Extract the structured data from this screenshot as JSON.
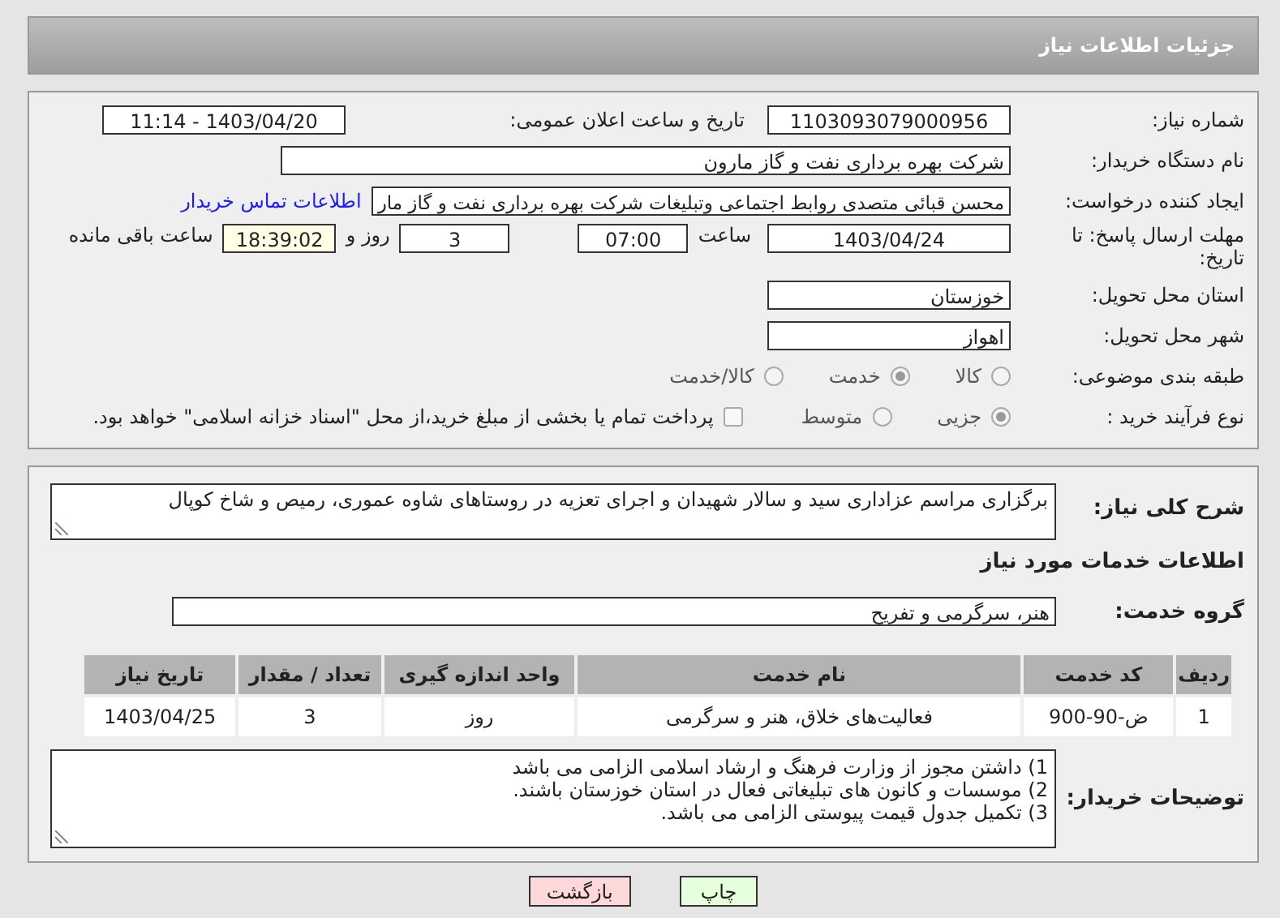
{
  "header": {
    "title": "جزئیات اطلاعات نیاز"
  },
  "need_number": {
    "label": "شماره نیاز:",
    "value": "1103093079000956"
  },
  "announce": {
    "label": "تاریخ و ساعت اعلان عمومی:",
    "value": "1403/04/20 - 11:14"
  },
  "buyer_org": {
    "label": "نام دستگاه خریدار:",
    "value": "شرکت بهره برداری نفت و گاز مارون"
  },
  "creator": {
    "label": "ایجاد کننده درخواست:",
    "value": "محسن قبائی متصدی روابط اجتماعی وتبلیغات شرکت بهره برداری نفت و گاز مار",
    "link": "اطلاعات تماس خریدار"
  },
  "deadline": {
    "label": "مهلت ارسال پاسخ: تا تاریخ:",
    "date": "1403/04/24",
    "time_label": "ساعت",
    "time": "07:00",
    "days": "3",
    "days_label": "روز و",
    "remaining": "18:39:02",
    "remaining_label": "ساعت باقی مانده"
  },
  "province": {
    "label": "استان محل تحویل:",
    "value": "خوزستان"
  },
  "city": {
    "label": "شهر محل تحویل:",
    "value": "اهواز"
  },
  "category": {
    "label": "طبقه بندی موضوعی:",
    "options": [
      {
        "label": "کالا",
        "selected": false
      },
      {
        "label": "خدمت",
        "selected": true
      },
      {
        "label": "کالا/خدمت",
        "selected": false
      }
    ]
  },
  "process": {
    "label": "نوع فرآیند خرید :",
    "options": [
      {
        "label": "جزیی",
        "selected": true
      },
      {
        "label": "متوسط",
        "selected": false
      }
    ],
    "payment": {
      "label": "پرداخت تمام یا بخشی از مبلغ خرید،از محل \"اسناد خزانه اسلامی\" خواهد بود.",
      "checked": false
    }
  },
  "description": {
    "label": "شرح کلی نیاز:",
    "value": "برگزاری مراسم  عزاداری سید و سالار شهیدان و اجرای تعزیه در روستاهای شاوه عموری، رمیص و شاخ کوپال"
  },
  "services_title": "اطلاعات خدمات مورد نیاز",
  "service_group": {
    "label": "گروه خدمت:",
    "value": "هنر، سرگرمی و تفریح"
  },
  "table": {
    "columns": [
      "ردیف",
      "کد خدمت",
      "نام خدمت",
      "واحد اندازه گیری",
      "تعداد / مقدار",
      "تاریخ نیاز"
    ],
    "rows": [
      [
        "1",
        "ض-90-900",
        "فعالیت‌های خلاق، هنر و سرگرمی",
        "روز",
        "3",
        "1403/04/25"
      ]
    ]
  },
  "buyer_notes": {
    "label": "توضیحات خریدار:",
    "lines": [
      "1) داشتن مجوز از وزارت فرهنگ و ارشاد اسلامی الزامی می باشد",
      "2) موسسات و کانون های تبلیغاتی فعال در استان خوزستان باشند.",
      "3) تکمیل جدول قیمت پیوستی الزامی می باشد."
    ]
  },
  "buttons": [
    {
      "label": "چاپ",
      "kind": "print"
    },
    {
      "label": "بازگشت",
      "kind": "back"
    }
  ]
}
